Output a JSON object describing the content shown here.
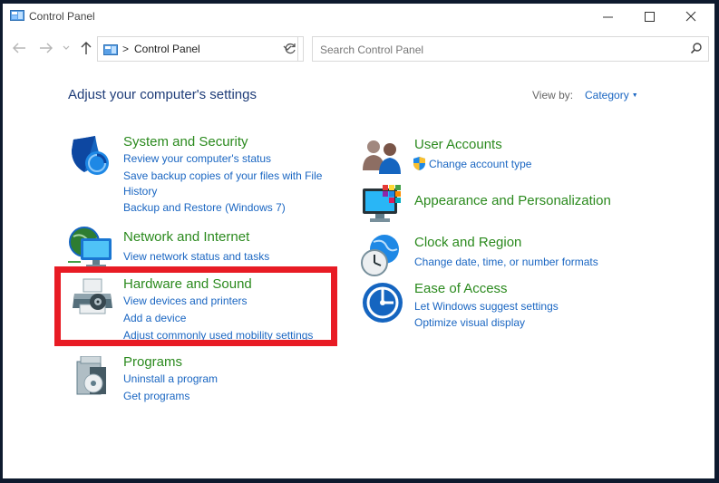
{
  "window": {
    "title": "Control Panel"
  },
  "titlebar": {
    "minimize_icon": "minimize-icon",
    "maximize_icon": "maximize-icon",
    "close_icon": "close-icon"
  },
  "nav": {
    "back_icon": "back-arrow-icon",
    "forward_icon": "forward-arrow-icon",
    "recent_icon": "chevron-down-icon",
    "up_icon": "up-arrow-icon"
  },
  "address": {
    "path": "Control Panel",
    "separator": ">"
  },
  "search": {
    "placeholder": "Search Control Panel",
    "value": ""
  },
  "main": {
    "heading": "Adjust your computer's settings",
    "view_by_label": "View by:",
    "view_by_value": "Category"
  },
  "categories": [
    {
      "title": "System and Security",
      "icon": "shield-icon",
      "links": [
        "Review your computer's status",
        "Save backup copies of your files with File",
        "History",
        "Backup and Restore (Windows 7)"
      ]
    },
    {
      "title": "Network and Internet",
      "icon": "network-globe-icon",
      "links": [
        "View network status and tasks"
      ]
    },
    {
      "title": "Hardware and Sound",
      "icon": "printer-icon",
      "links": [
        "View devices and printers",
        "Add a device",
        "Adjust commonly used mobility settings"
      ]
    },
    {
      "title": "Programs",
      "icon": "programs-disc-icon",
      "links": [
        "Uninstall a program",
        "Get programs"
      ]
    },
    {
      "title": "User Accounts",
      "icon": "users-icon",
      "links": [
        "Change account type"
      ]
    },
    {
      "title": "Appearance and Personalization",
      "icon": "monitor-palette-icon",
      "links": []
    },
    {
      "title": "Clock and Region",
      "icon": "clock-globe-icon",
      "links": [
        "Change date, time, or number formats"
      ]
    },
    {
      "title": "Ease of Access",
      "icon": "ease-of-access-icon",
      "links": [
        "Let Windows suggest settings",
        "Optimize visual display"
      ]
    }
  ],
  "colors": {
    "category_title": "#2b8a1e",
    "link": "#1a66c2",
    "heading": "#1e3c78",
    "highlight": "#e81b24"
  }
}
